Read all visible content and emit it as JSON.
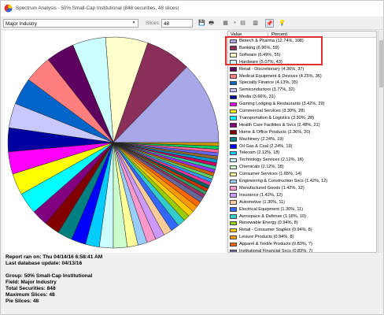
{
  "window": {
    "title": "Spectrum Analysis - 50% Small-Cap Institutional (848 securities, 48 slices)"
  },
  "toolbar": {
    "field_select": "Major Industry",
    "slices_label": "Slices:",
    "slices_value": "48"
  },
  "legend": {
    "col_value": "Value",
    "col_percent": "Percent",
    "items": [
      {
        "label": "Biotech & Pharma (12.74%, 108)",
        "color": "#a8a8e8"
      },
      {
        "label": "Banking (6.96%, 59)",
        "color": "#8a2e5a"
      },
      {
        "label": "Software (6.49%, 55)",
        "color": "#ffffcc"
      },
      {
        "label": "Hardware (5.07%, 43)",
        "color": "#ccffff"
      },
      {
        "label": "Retail - Discretionary (4.36%, 37)",
        "color": "#5e005e"
      },
      {
        "label": "Medical Equipment & Devices (4.25%, 36)",
        "color": "#ff7f7f"
      },
      {
        "label": "Specialty Finance (4.13%, 35)",
        "color": "#0064c8"
      },
      {
        "label": "Semiconductors (3.77%, 32)",
        "color": "#c8c8ff"
      },
      {
        "label": "Media (3.66%, 31)",
        "color": "#0000a0"
      },
      {
        "label": "Gaming Lodging & Restaurants (3.42%, 29)",
        "color": "#ff00ff"
      },
      {
        "label": "Commercial Services (3.30%, 28)",
        "color": "#ffff00"
      },
      {
        "label": "Transportation & Logistics (3.30%, 28)",
        "color": "#00ffff"
      },
      {
        "label": "Health Care Facilities & Svcs (2.48%, 21)",
        "color": "#800080"
      },
      {
        "label": "Home & Office Products (2.36%, 20)",
        "color": "#800000"
      },
      {
        "label": "Machinery (2.24%, 19)",
        "color": "#008080"
      },
      {
        "label": "Oil Gas & Coal (2.24%, 19)",
        "color": "#0000ff"
      },
      {
        "label": "Telecom (2.12%, 18)",
        "color": "#00ccff"
      },
      {
        "label": "Technology Services (2.12%, 18)",
        "color": "#ccffff"
      },
      {
        "label": "Chemicals (2.12%, 18)",
        "color": "#ccffcc"
      },
      {
        "label": "Consumer Services (1.65%, 14)",
        "color": "#ffff99"
      },
      {
        "label": "Engineering & Construction Svcs (1.42%, 12)",
        "color": "#99ccff"
      },
      {
        "label": "Manufactured Goods (1.42%, 12)",
        "color": "#ff99cc"
      },
      {
        "label": "Insurance (1.42%, 12)",
        "color": "#cc99ff"
      },
      {
        "label": "Automotive (1.30%, 11)",
        "color": "#ffcc99"
      },
      {
        "label": "Electrical Equipment (1.30%, 11)",
        "color": "#3366ff"
      },
      {
        "label": "Aerospace & Defense (1.18%, 10)",
        "color": "#33cccc"
      },
      {
        "label": "Renewable Energy (0.94%, 8)",
        "color": "#99cc00"
      },
      {
        "label": "Retail - Consumer Staples (0.94%, 8)",
        "color": "#ffcc00"
      },
      {
        "label": "Leisure Products (0.94%, 8)",
        "color": "#ff9900"
      },
      {
        "label": "Apparel & Textile Products (0.83%, 7)",
        "color": "#ff6600"
      },
      {
        "label": "Institutional Financial Svcs (0.83%, 7)",
        "color": "#666699"
      }
    ]
  },
  "report": {
    "run_on": "Report ran on: Thu 04/14/16 6:58:41 AM",
    "last_update": "Last database update: 04/13/16",
    "group": "Group: 50% Small-Cap Institutional",
    "field": "Field: Major Industry",
    "total": "Total Securities: 848",
    "max_slices": "Maximum Slices: 48",
    "pie_slices": "Pie Slices: 48"
  },
  "chart_data": {
    "type": "pie",
    "total": 848,
    "slices": [
      {
        "label": "Biotech & Pharma",
        "value": 108,
        "color": "#a8a8e8"
      },
      {
        "label": "Banking",
        "value": 59,
        "color": "#8a2e5a"
      },
      {
        "label": "Software",
        "value": 55,
        "color": "#ffffcc"
      },
      {
        "label": "Hardware",
        "value": 43,
        "color": "#ccffff"
      },
      {
        "label": "Retail - Discretionary",
        "value": 37,
        "color": "#5e005e"
      },
      {
        "label": "Medical Equipment & Devices",
        "value": 36,
        "color": "#ff7f7f"
      },
      {
        "label": "Specialty Finance",
        "value": 35,
        "color": "#0064c8"
      },
      {
        "label": "Semiconductors",
        "value": 32,
        "color": "#c8c8ff"
      },
      {
        "label": "Media",
        "value": 31,
        "color": "#0000a0"
      },
      {
        "label": "Gaming Lodging & Restaurants",
        "value": 29,
        "color": "#ff00ff"
      },
      {
        "label": "Commercial Services",
        "value": 28,
        "color": "#ffff00"
      },
      {
        "label": "Transportation & Logistics",
        "value": 28,
        "color": "#00ffff"
      },
      {
        "label": "Health Care Facilities & Svcs",
        "value": 21,
        "color": "#800080"
      },
      {
        "label": "Home & Office Products",
        "value": 20,
        "color": "#800000"
      },
      {
        "label": "Machinery",
        "value": 19,
        "color": "#008080"
      },
      {
        "label": "Oil Gas & Coal",
        "value": 19,
        "color": "#0000ff"
      },
      {
        "label": "Telecom",
        "value": 18,
        "color": "#00ccff"
      },
      {
        "label": "Technology Services",
        "value": 18,
        "color": "#ccffff"
      },
      {
        "label": "Chemicals",
        "value": 18,
        "color": "#ccffcc"
      },
      {
        "label": "Consumer Services",
        "value": 14,
        "color": "#ffff99"
      },
      {
        "label": "Engineering & Construction Svcs",
        "value": 12,
        "color": "#99ccff"
      },
      {
        "label": "Manufactured Goods",
        "value": 12,
        "color": "#ff99cc"
      },
      {
        "label": "Insurance",
        "value": 12,
        "color": "#cc99ff"
      },
      {
        "label": "Automotive",
        "value": 11,
        "color": "#ffcc99"
      },
      {
        "label": "Electrical Equipment",
        "value": 11,
        "color": "#3366ff"
      },
      {
        "label": "Aerospace & Defense",
        "value": 10,
        "color": "#33cccc"
      },
      {
        "label": "Renewable Energy",
        "value": 8,
        "color": "#99cc00"
      },
      {
        "label": "Retail - Consumer Staples",
        "value": 8,
        "color": "#ffcc00"
      },
      {
        "label": "Leisure Products",
        "value": 8,
        "color": "#ff9900"
      },
      {
        "label": "Apparel & Textile Products",
        "value": 7,
        "color": "#ff6600"
      },
      {
        "label": "Institutional Financial Svcs",
        "value": 7,
        "color": "#666699"
      }
    ]
  }
}
